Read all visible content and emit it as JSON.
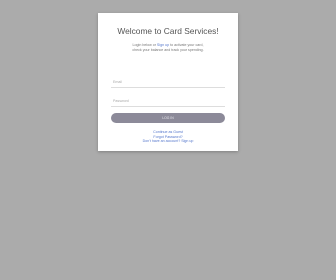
{
  "card": {
    "title": "Welcome to Card Services!",
    "intro_before": "Login below or ",
    "intro_link": "Sign up",
    "intro_line1_after": " to activate your card,",
    "intro_line2": "check your balance and track your spending.",
    "email_placeholder": "Email",
    "password_placeholder": "Password",
    "login_label": "LOG IN",
    "links": [
      "Continue as Guest",
      "Forgot Password?",
      "Don't have an account? Sign up"
    ]
  }
}
